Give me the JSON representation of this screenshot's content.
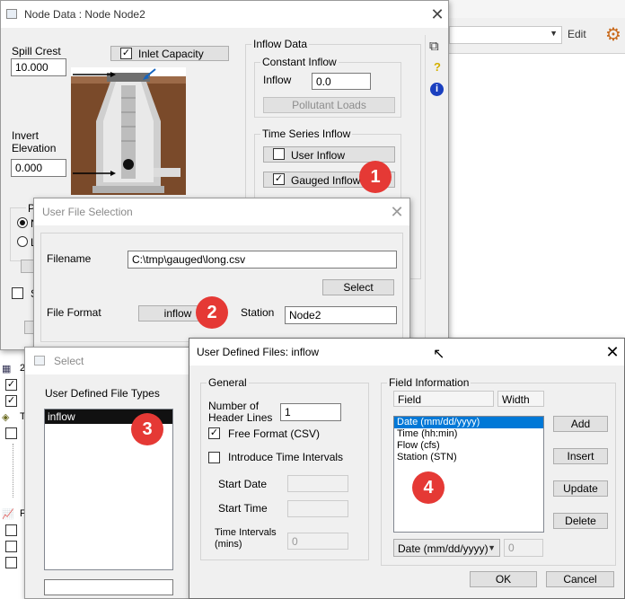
{
  "background_app": {
    "edit_label": "Edit",
    "dropdown_icon": "chevron-down-icon",
    "app_icon": "gear-icon"
  },
  "node_data": {
    "title": "Node Data : Node Node2",
    "spill_crest_label": "Spill Crest",
    "spill_crest_value": "10.000",
    "inlet_capacity_label": "Inlet Capacity",
    "invert_label_1": "Invert",
    "invert_label_2": "Elevation",
    "invert_value": "0.000",
    "inflow_data_label": "Inflow Data",
    "constant_inflow_label": "Constant Inflow",
    "inflow_label": "Inflow",
    "inflow_value": "0.0",
    "pollutant_loads_label": "Pollutant Loads",
    "time_series_label": "Time Series Inflow",
    "user_inflow_label": "User Inflow",
    "gauged_inflow_label": "Gauged Inflow",
    "partial_po": "Po",
    "partial_n": "N",
    "partial_l": "L",
    "partial_s": "S"
  },
  "left_panel": {
    "partial_2": "2",
    "partial_t": "T",
    "partial_f": "F"
  },
  "user_file_selection": {
    "title": "User File Selection",
    "filename_label": "Filename",
    "filename_value": "C:\\tmp\\gauged\\long.csv",
    "select_button": "Select",
    "file_format_label": "File Format",
    "file_format_button": "inflow",
    "station_label": "Station",
    "station_value": "Node2"
  },
  "select_dialog": {
    "title": "Select",
    "types_label": "User Defined File Types",
    "items": [
      "inflow"
    ]
  },
  "udf": {
    "title": "User Defined Files: inflow",
    "general_label": "General",
    "header_lines_label_1": "Number of",
    "header_lines_label_2": "Header Lines",
    "header_lines_value": "1",
    "free_format_label": "Free Format (CSV)",
    "introduce_intervals_label": "Introduce Time Intervals",
    "start_date_label": "Start Date",
    "start_time_label": "Start Time",
    "time_intervals_label_1": "Time Intervals",
    "time_intervals_label_2": "(mins)",
    "time_intervals_value": "0",
    "field_info_label": "Field Information",
    "field_col": "Field",
    "width_col": "Width",
    "fields": [
      "Date (mm/dd/yyyy)",
      "Time (hh:min)",
      "Flow (cfs)",
      "Station (STN)"
    ],
    "add_button": "Add",
    "insert_button": "Insert",
    "update_button": "Update",
    "delete_button": "Delete",
    "field_select_value": "Date (mm/dd/yyyy)",
    "width_value": "0",
    "ok_button": "OK",
    "cancel_button": "Cancel"
  },
  "badges": {
    "b1": "1",
    "b2": "2",
    "b3": "3",
    "b4": "4"
  }
}
